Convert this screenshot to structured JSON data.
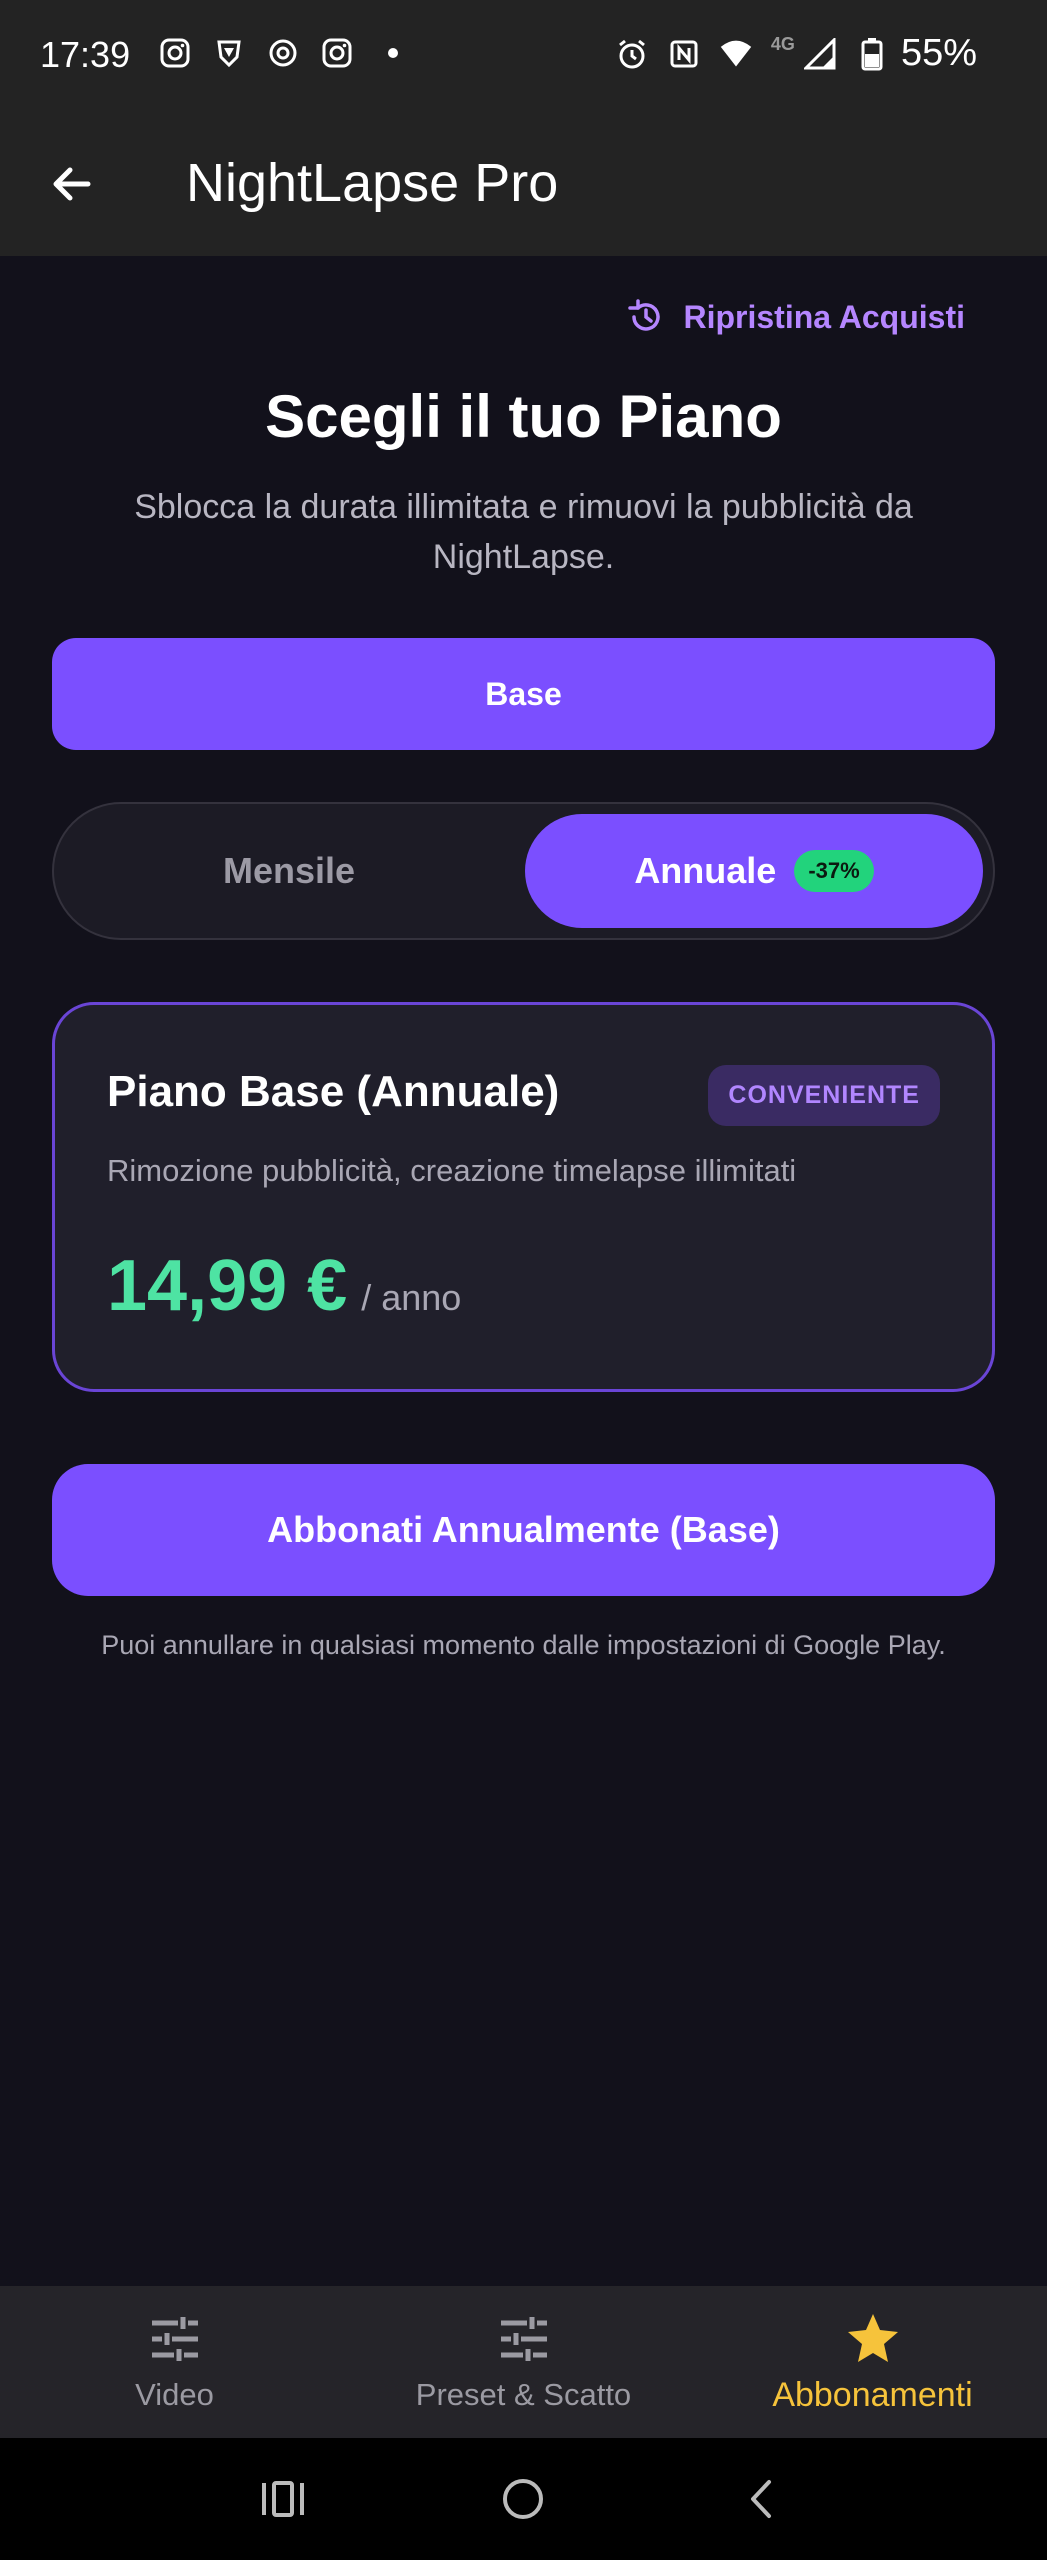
{
  "status_bar": {
    "time": "17:39",
    "network": "4G",
    "battery": "55%"
  },
  "app_bar": {
    "title": "NightLapse Pro"
  },
  "restore": {
    "label": "Ripristina Acquisti"
  },
  "header": {
    "title": "Scegli il tuo Piano",
    "subtitle": "Sblocca la durata illimitata e rimuovi la pubblicità da NightLapse."
  },
  "tier_selector": {
    "label": "Base"
  },
  "billing_toggle": {
    "monthly_label": "Mensile",
    "annual_label": "Annuale",
    "annual_discount": "-37%",
    "selected": "annual"
  },
  "plan_card": {
    "name": "Piano Base (Annuale)",
    "badge": "CONVENIENTE",
    "description": "Rimozione pubblicità, creazione timelapse illimitati",
    "price": "14,99 €",
    "period": "/ anno"
  },
  "subscribe_button": {
    "label": "Abbonati Annualmente (Base)"
  },
  "footnote": "Puoi annullare in qualsiasi momento dalle impostazioni di Google Play.",
  "bottom_nav": {
    "items": [
      {
        "label": "Video",
        "icon": "sliders-icon",
        "active": false
      },
      {
        "label": "Preset & Scatto",
        "icon": "sliders-icon",
        "active": false
      },
      {
        "label": "Abbonamenti",
        "icon": "star-icon",
        "active": true
      }
    ]
  },
  "colors": {
    "accent": "#7b4fff",
    "price": "#4ee3a3",
    "discount": "#22d37c",
    "active_nav": "#f6c33b",
    "restore_link": "#b586ff"
  }
}
